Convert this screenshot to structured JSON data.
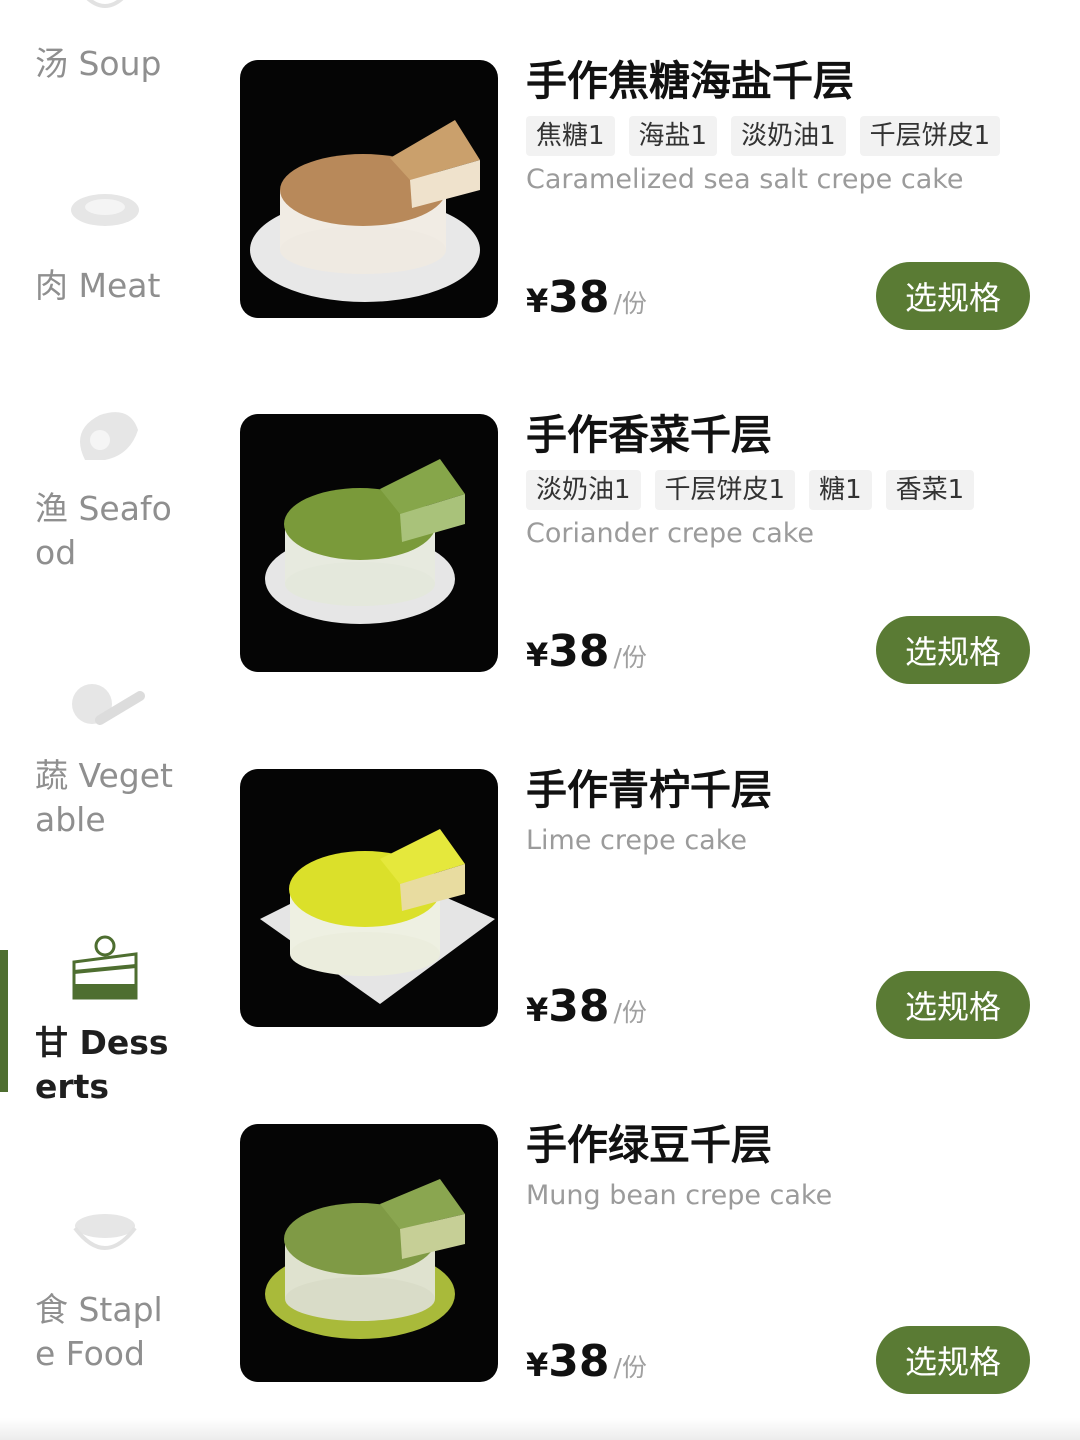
{
  "categories": [
    {
      "label": "汤 Soup",
      "icon": "soup-bowl-icon",
      "active": false
    },
    {
      "label": "肉 Meat",
      "icon": "meat-icon",
      "active": false
    },
    {
      "label": "渔 Seafood",
      "icon": "shrimp-icon",
      "active": false
    },
    {
      "label": "蔬 Vegetable",
      "icon": "vegetable-icon",
      "active": false
    },
    {
      "label": "甘 Desserts",
      "icon": "cake-slice-icon",
      "active": true
    },
    {
      "label": "食 Staple Food",
      "icon": "rice-bowl-icon",
      "active": false
    }
  ],
  "products": [
    {
      "name": "手作焦糖海盐千层",
      "tags": [
        "焦糖1",
        "海盐1",
        "淡奶油1",
        "千层饼皮1"
      ],
      "en_name": "Caramelized sea salt crepe cake",
      "currency": "¥",
      "price": "38",
      "unit": "/份",
      "button": "选规格",
      "image": "caramel-crepe-cake-image"
    },
    {
      "name": "手作香菜千层",
      "tags": [
        "淡奶油1",
        "千层饼皮1",
        "糖1",
        "香菜1"
      ],
      "en_name": "Coriander crepe cake",
      "currency": "¥",
      "price": "38",
      "unit": "/份",
      "button": "选规格",
      "image": "coriander-crepe-cake-image"
    },
    {
      "name": "手作青柠千层",
      "tags": [],
      "en_name": "Lime crepe cake",
      "currency": "¥",
      "price": "38",
      "unit": "/份",
      "button": "选规格",
      "image": "lime-crepe-cake-image"
    },
    {
      "name": "手作绿豆千层",
      "tags": [],
      "en_name": "Mung bean crepe cake",
      "currency": "¥",
      "price": "38",
      "unit": "/份",
      "button": "选规格",
      "image": "mung-bean-crepe-cake-image"
    }
  ],
  "colors": {
    "accent": "#5a7b34",
    "active_bar": "#4e6e30",
    "inactive_text": "#8f8f8f"
  }
}
